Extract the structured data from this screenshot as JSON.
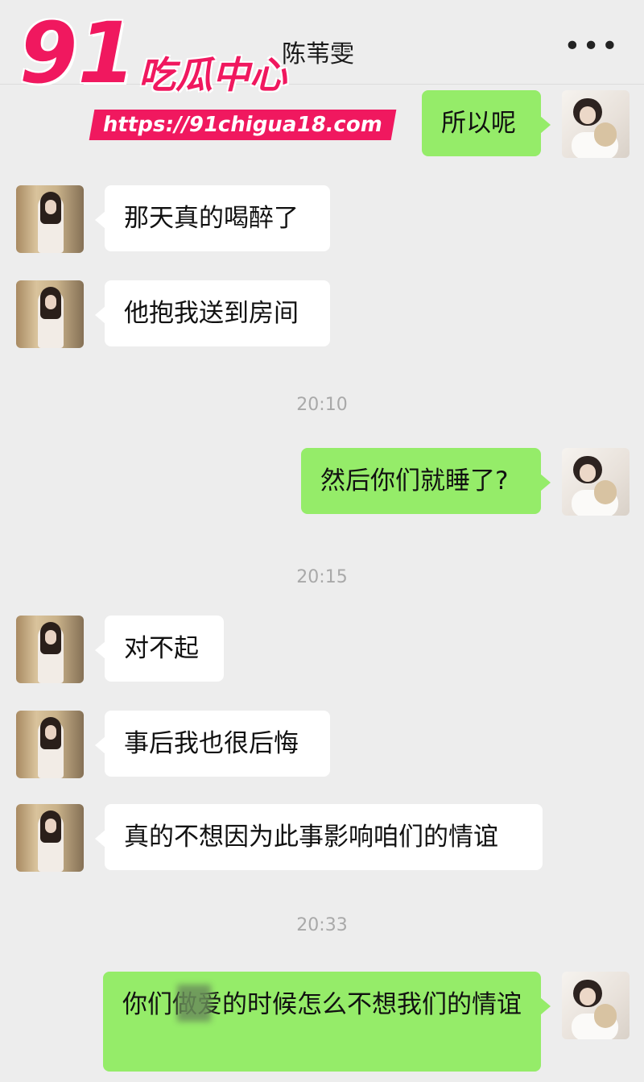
{
  "header": {
    "title": "陈苇雯",
    "more_label": "•••"
  },
  "watermark": {
    "number": "91",
    "text": "吃瓜中心",
    "url": "https://91chigua18.com"
  },
  "messages": [
    {
      "side": "out",
      "text": "所以呢"
    },
    {
      "side": "in",
      "text": "那天真的喝醉了"
    },
    {
      "side": "in",
      "text": "他抱我送到房间"
    },
    {
      "time": "20:10"
    },
    {
      "side": "out",
      "text": "然后你们就睡了?"
    },
    {
      "time": "20:15"
    },
    {
      "side": "in",
      "text": "对不起"
    },
    {
      "side": "in",
      "text": "事后我也很后悔"
    },
    {
      "side": "in",
      "text": "真的不想因为此事影响咱们的情谊"
    },
    {
      "time": "20:33"
    },
    {
      "side": "out",
      "text": "你们做爱的时候怎么不想我们的情谊"
    }
  ],
  "colors": {
    "background": "#ededed",
    "outgoing": "#95ec69",
    "incoming": "#ffffff",
    "watermark": "#f0185f"
  }
}
